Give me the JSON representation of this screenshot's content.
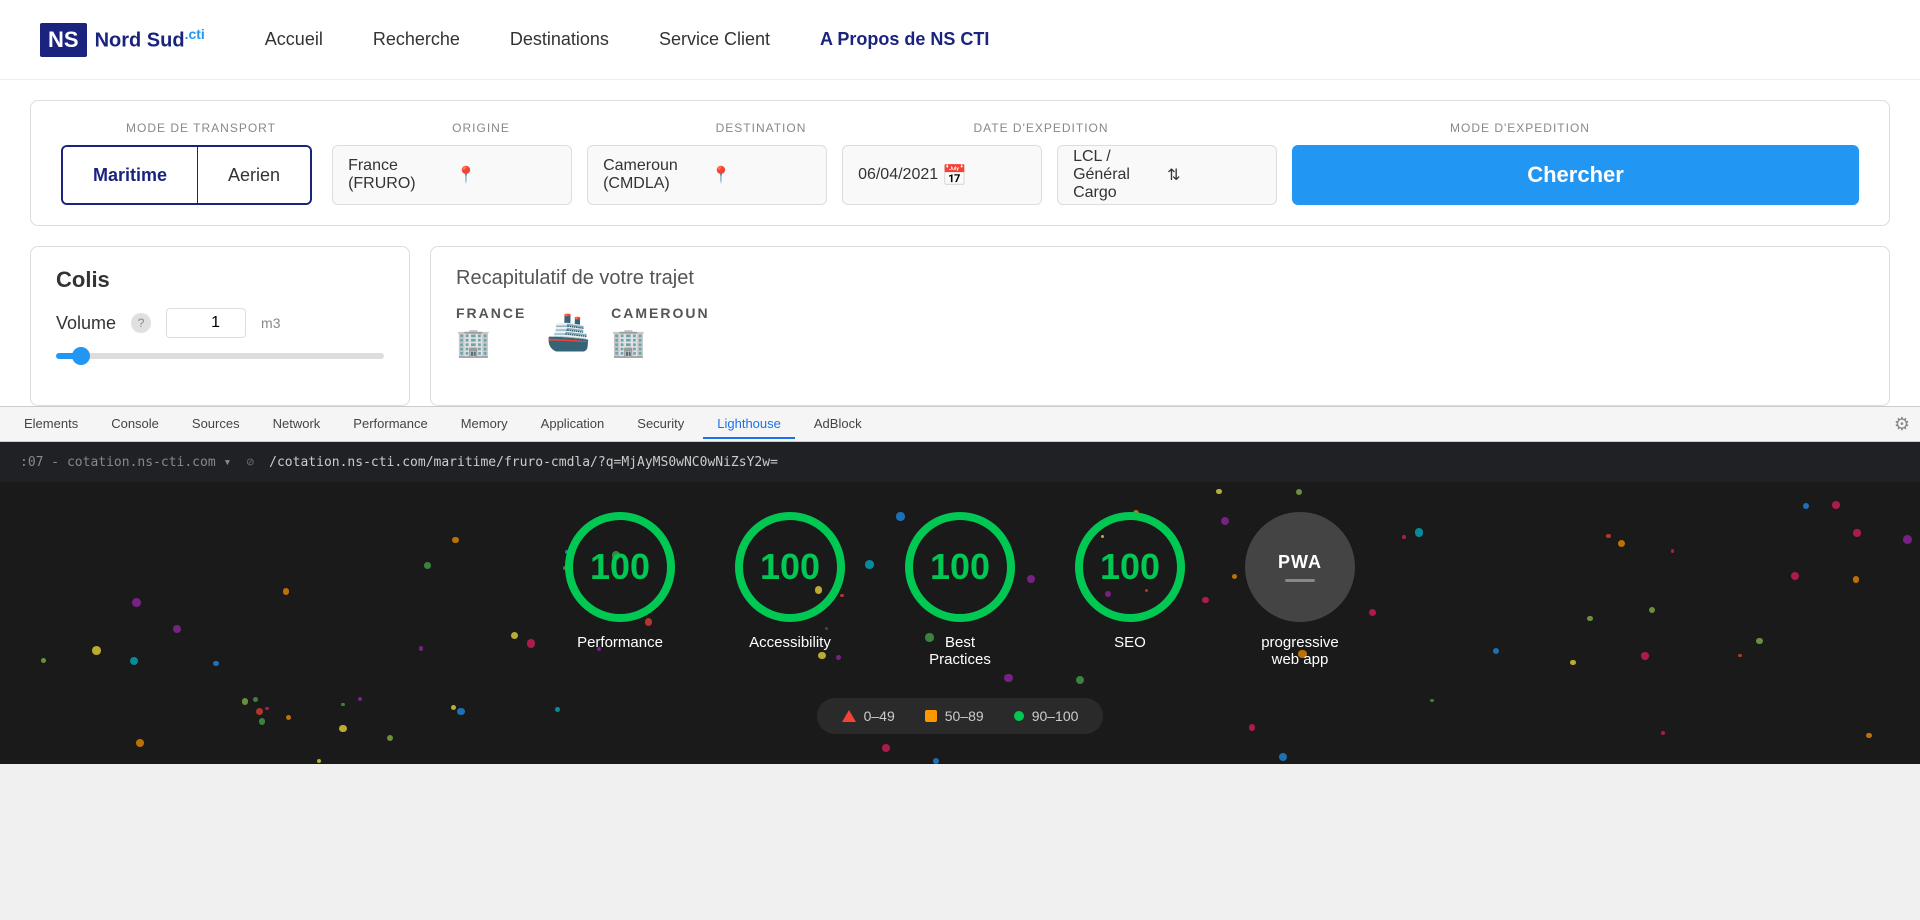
{
  "logo": {
    "ns_text": "NS",
    "brand_text": "Nord Sud",
    "cti_text": ".cti"
  },
  "navbar": {
    "links": [
      {
        "label": "Accueil",
        "active": false
      },
      {
        "label": "Recherche",
        "active": false
      },
      {
        "label": "Destinations",
        "active": false
      },
      {
        "label": "Service Client",
        "active": false
      },
      {
        "label": "A Propos de NS CTI",
        "active": true
      }
    ]
  },
  "search": {
    "labels": {
      "mode": "MODE DE TRANSPORT",
      "origine": "ORIGINE",
      "destination": "DESTINATION",
      "date": "DATE D'EXPEDITION",
      "expedition": "MODE D'EXPEDITION"
    },
    "modes": [
      "Maritime",
      "Aerien"
    ],
    "active_mode": "Maritime",
    "origine_value": "France (FRURO)",
    "destination_value": "Cameroun (CMDLA)",
    "date_value": "06/04/2021",
    "expedition_value": "LCL / Général Cargo",
    "chercher_label": "Chercher"
  },
  "colis": {
    "title": "Colis",
    "volume_label": "Volume",
    "volume_value": "1",
    "volume_unit": "m3"
  },
  "recap": {
    "title": "Recapitulatif de votre trajet",
    "origin_label": "FRANCE",
    "destination_label": "CAMEROUN"
  },
  "devtools": {
    "tabs": [
      "Elements",
      "Console",
      "Sources",
      "Network",
      "Performance",
      "Memory",
      "Application",
      "Security",
      "Lighthouse",
      "AdBlock"
    ],
    "active_tab": "Lighthouse",
    "url": "/cotation.ns-cti.com/maritime/fruro-cmdla/?q=MjAyMS0wNC0wNiZsY2w="
  },
  "lighthouse": {
    "scores": [
      {
        "value": "100",
        "label": "Performance"
      },
      {
        "value": "100",
        "label": "Accessibility"
      },
      {
        "value": "100",
        "label": "Best\nPractices"
      },
      {
        "value": "100",
        "label": "SEO"
      },
      {
        "value": "PWA",
        "label": "progressive\nweb app",
        "is_pwa": true
      }
    ],
    "legend": [
      {
        "type": "triangle",
        "range": "0–49"
      },
      {
        "type": "square",
        "range": "50–89"
      },
      {
        "type": "dot",
        "range": "90–100"
      }
    ]
  }
}
